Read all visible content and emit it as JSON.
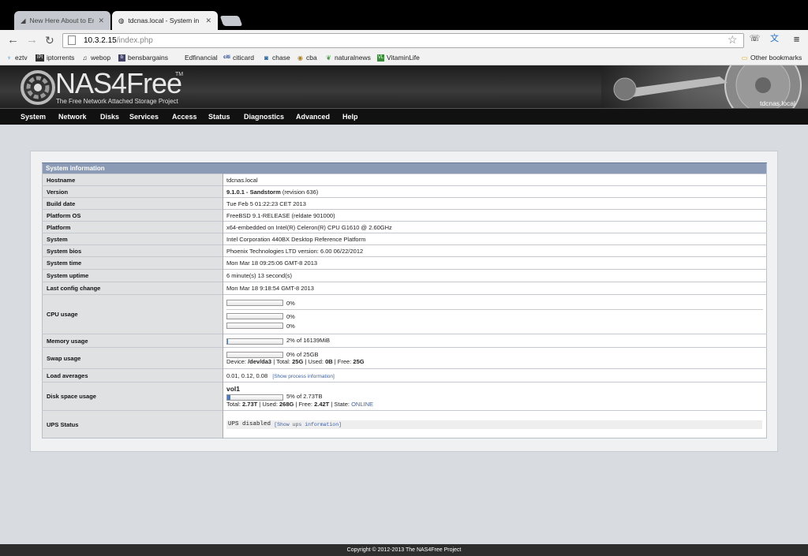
{
  "browser": {
    "tabs": [
      {
        "title": "New Here About to Emb",
        "active": false
      },
      {
        "title": "tdcnas.local - System in",
        "active": true
      }
    ],
    "url_host": "10.3.2.15",
    "url_path": "/index.php",
    "bookmarks": [
      {
        "label": "eztv",
        "icon": "eztv-icon"
      },
      {
        "label": "iptorrents",
        "icon": "ipt-icon"
      },
      {
        "label": "webop",
        "icon": "music-note-icon"
      },
      {
        "label": "bensbargains",
        "icon": "bb-icon"
      },
      {
        "label": "Edfinancial",
        "icon": "none"
      },
      {
        "label": "citicard",
        "icon": "citi-icon"
      },
      {
        "label": "chase",
        "icon": "chase-icon"
      },
      {
        "label": "cba",
        "icon": "cba-icon"
      },
      {
        "label": "naturalnews",
        "icon": "leaf-icon"
      },
      {
        "label": "VitaminLife",
        "icon": "vl-icon"
      }
    ],
    "other_bookmarks": "Other bookmarks"
  },
  "header": {
    "logo_text": "NAS4Free",
    "tm": "TM",
    "tagline": "The Free Network Attached Storage Project",
    "hostname": "tdcnas.local"
  },
  "menu": [
    "System",
    "Network",
    "Disks",
    "Services",
    "Access",
    "Status",
    "Diagnostics",
    "Advanced",
    "Help"
  ],
  "sysinfo": {
    "title": "System information",
    "hostname": {
      "label": "Hostname",
      "value": "tdcnas.local"
    },
    "version": {
      "label": "Version",
      "bold": "9.1.0.1 - Sandstorm",
      "rest": " (revision 636)"
    },
    "build_date": {
      "label": "Build date",
      "value": "Tue Feb 5 01:22:23 CET 2013"
    },
    "platform_os": {
      "label": "Platform OS",
      "value": "FreeBSD 9.1-RELEASE (reldate 901000)"
    },
    "platform": {
      "label": "Platform",
      "value": "x64-embedded on Intel(R) Celeron(R) CPU G1610 @ 2.60GHz"
    },
    "system": {
      "label": "System",
      "value": "Intel Corporation 440BX Desktop Reference Platform"
    },
    "system_bios": {
      "label": "System bios",
      "value": "Phoenix Technologies LTD version: 6.00 06/22/2012"
    },
    "system_time": {
      "label": "System time",
      "value": "Mon Mar 18 09:25:06 GMT-8 2013"
    },
    "system_uptime": {
      "label": "System uptime",
      "value": "6 minute(s) 13 second(s)"
    },
    "last_config": {
      "label": "Last config change",
      "value": "Mon Mar 18 9:18:54 GMT-8 2013"
    },
    "cpu": {
      "label": "CPU usage",
      "total": "0%",
      "core0": "0%",
      "core1": "0%",
      "total_frac": 0,
      "core0_frac": 0,
      "core1_frac": 0
    },
    "memory": {
      "label": "Memory usage",
      "text": "2% of 16139MiB",
      "frac": 0.02
    },
    "swap": {
      "label": "Swap usage",
      "text": "0% of 25GB",
      "frac": 0,
      "device_label": "Device: ",
      "device": "/dev/da3",
      "total_label": " | Total: ",
      "total": "25G",
      "used_label": " | Used: ",
      "used": "0B",
      "free_label": " | Free: ",
      "free": "25G"
    },
    "load": {
      "label": "Load averages",
      "value": "0.01, 0.12, 0.08",
      "link": "[Show process information]"
    },
    "disk": {
      "label": "Disk space usage",
      "name": "vol1",
      "text": "5% of 2.73TB",
      "frac": 0.05,
      "total_label": "Total: ",
      "total": "2.73T",
      "used_label": " | Used: ",
      "used": "268G",
      "free_label": " | Free: ",
      "free": "2.42T",
      "state_label": " | State: ",
      "state": "ONLINE"
    },
    "ups": {
      "label": "UPS Status",
      "value": "UPS disabled",
      "link": "[Show ups information]"
    }
  },
  "footer": "Copyright © 2012-2013 The NAS4Free Project",
  "colors": {
    "accent": "#8b9bb5",
    "link": "#3b5fa8",
    "bar_fill": "#4a7bc0"
  }
}
